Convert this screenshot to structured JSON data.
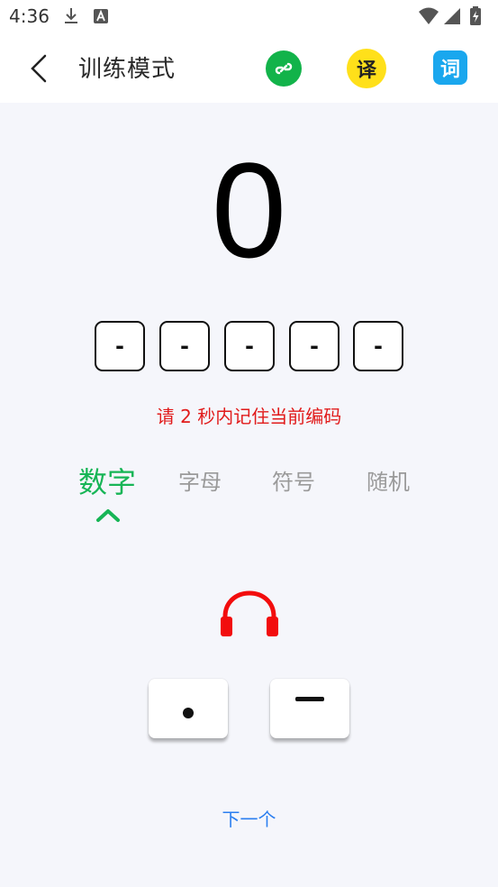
{
  "status_bar": {
    "time": "4:36"
  },
  "app_bar": {
    "title": "训练模式",
    "translate_label": "译",
    "dictionary_label": "词"
  },
  "score": "0",
  "code_slots": [
    "-",
    "-",
    "-",
    "-",
    "-"
  ],
  "hint": "请 2 秒内记住当前编码",
  "tabs": [
    {
      "label": "数字",
      "active": true
    },
    {
      "label": "字母",
      "active": false
    },
    {
      "label": "符号",
      "active": false
    },
    {
      "label": "随机",
      "active": false
    }
  ],
  "next_label": "下一个",
  "colors": {
    "accent_green": "#17b556",
    "hint_red": "#e11b1b",
    "link_blue": "#2a7ef0",
    "translate_yellow": "#ffe01a",
    "dictionary_blue": "#1aa7ee"
  },
  "icons": {
    "back": "chevron-left-icon",
    "link": "link-icon",
    "headphones": "headphones-icon",
    "dot": "morse-dot",
    "dash": "morse-dash"
  }
}
